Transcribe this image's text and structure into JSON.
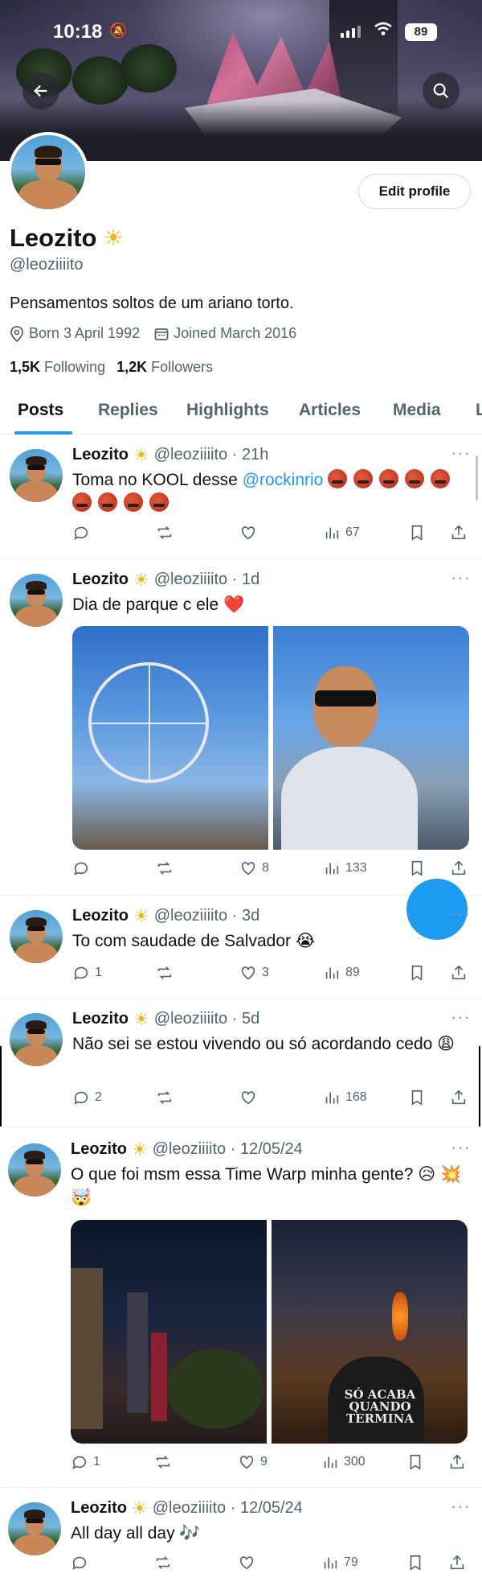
{
  "status": {
    "time": "10:18",
    "battery": "89"
  },
  "profile": {
    "name": "Leozito",
    "handle": "@leoziiiito",
    "bio": "Pensamentos soltos de um ariano torto.",
    "born": "Born 3 April 1992",
    "joined": "Joined March 2016",
    "following_count": "1,5K",
    "following_label": "Following",
    "followers_count": "1,2K",
    "followers_label": "Followers",
    "edit_label": "Edit profile"
  },
  "tabs": [
    "Posts",
    "Replies",
    "Highlights",
    "Articles",
    "Media",
    "L"
  ],
  "posts": [
    {
      "name": "Leozito",
      "meta": "@leoziiiito · 21h",
      "text_pre": "Toma no KOOL desse ",
      "mention": "@rockinrio",
      "views": "67",
      "replies": "",
      "likes": ""
    },
    {
      "name": "Leozito",
      "meta": "@leoziiiito · 1d",
      "text": "Dia de parque c ele ❤️",
      "likes": "8",
      "views": "133",
      "replies": ""
    },
    {
      "name": "Leozito",
      "meta": "@leoziiiito · 3d",
      "text": "To com saudade de Salvador 😭",
      "replies": "1",
      "likes": "3",
      "views": "89"
    },
    {
      "name": "Leozito",
      "meta": "@leoziiiito · 5d",
      "text": "Não sei se estou vivendo ou só acordando cedo 😩",
      "replies": "2",
      "likes": "",
      "views": "168"
    },
    {
      "name": "Leozito",
      "meta": "@leoziiiito · 12/05/24",
      "text": "O que foi msm essa Time Warp minha gente? 😥 💥 🤯",
      "replies": "1",
      "likes": "9",
      "views": "300"
    },
    {
      "name": "Leozito",
      "meta": "@leoziiiito · 12/05/24",
      "text": "All day all day 🎶",
      "replies": "",
      "likes": "",
      "views": "79"
    }
  ],
  "photo_text": "SÓ ACABA QUANDO TERMINA"
}
